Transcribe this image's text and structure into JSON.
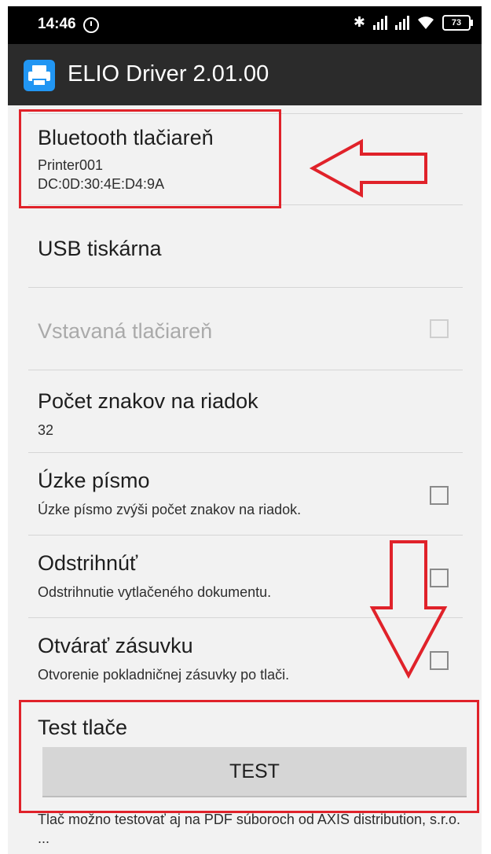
{
  "status_bar": {
    "time": "14:46",
    "battery": "73"
  },
  "app_bar": {
    "title": "ELIO Driver 2.01.00"
  },
  "settings": {
    "bluetooth": {
      "title": "Bluetooth tlačiareň",
      "name": "Printer001",
      "address": "DC:0D:30:4E:D4:9A"
    },
    "usb": {
      "title": "USB tiskárna"
    },
    "builtin": {
      "title": "Vstavaná tlačiareň",
      "checked": false,
      "enabled": false
    },
    "chars_per_line": {
      "title": "Počet znakov na riadok",
      "value": "32"
    },
    "narrow_font": {
      "title": "Úzke písmo",
      "summary": "Úzke písmo zvýši počet znakov na riadok.",
      "checked": false
    },
    "cut": {
      "title": "Odstrihnúť",
      "summary": "Odstrihnutie vytlačeného dokumentu.",
      "checked": false
    },
    "drawer": {
      "title": "Otvárať zásuvku",
      "summary": "Otvorenie pokladničnej zásuvky po tlači.",
      "checked": false
    },
    "print_test": {
      "title": "Test tlače",
      "button": "TEST",
      "note": "Tlač možno testovať aj na PDF súboroch od AXIS distribution, s.r.o. ..."
    }
  },
  "colors": {
    "annotation": "#e0222a",
    "app_bar": "#2b2b2b",
    "app_icon": "#2196f3"
  }
}
